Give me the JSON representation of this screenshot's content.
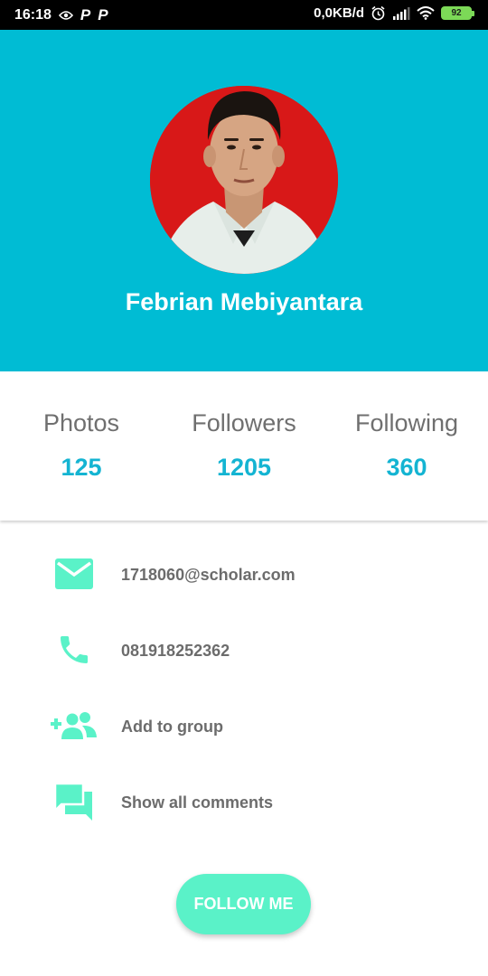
{
  "status_bar": {
    "time": "16:18",
    "left_icons": [
      "eye-wifi-icon",
      "parking-p-icon",
      "parking-p-icon"
    ],
    "p_glyph": "P",
    "net_speed": "0,0KB/d",
    "right_icons": [
      "alarm-icon",
      "signal-icon",
      "wifi-icon"
    ],
    "battery": "92"
  },
  "profile": {
    "name": "Febrian Mebiyantara",
    "header_color": "#00bcd4",
    "avatar_background": "#d81818"
  },
  "stats": [
    {
      "label": "Photos",
      "value": "125"
    },
    {
      "label": "Followers",
      "value": "1205"
    },
    {
      "label": "Following",
      "value": "360"
    }
  ],
  "info": [
    {
      "icon": "email-icon",
      "text": "1718060@scholar.com"
    },
    {
      "icon": "phone-icon",
      "text": "081918252362"
    },
    {
      "icon": "group-add-icon",
      "text": "Add to group"
    },
    {
      "icon": "comments-icon",
      "text": "Show all comments"
    }
  ],
  "follow_button": {
    "label": "FOLLOW ME",
    "color": "#5af2c8"
  },
  "colors": {
    "accent": "#14b4d2",
    "icon": "#5af2c8"
  }
}
